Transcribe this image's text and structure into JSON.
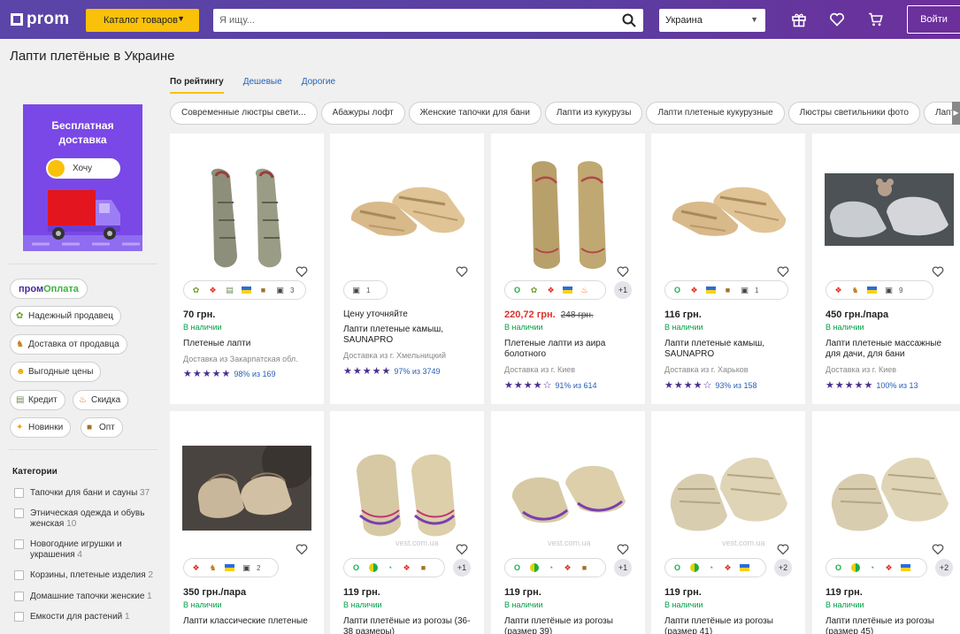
{
  "header": {
    "logo": "prom",
    "catalog_label": "Каталог товаров",
    "search_placeholder": "Я ищу...",
    "region": "Украина",
    "login_label": "Войти"
  },
  "page_title": "Лапти плетёные в Украине",
  "sort_tabs": [
    "По рейтингу",
    "Дешевые",
    "Дорогие"
  ],
  "chips": [
    "Современные люстры свети...",
    "Абажуры лофт",
    "Женские тапочки для бани",
    "Лапти из кукурузы",
    "Лапти плетеные кукурузные",
    "Люстры светильники фото",
    "Лапти"
  ],
  "promo": {
    "title_line1": "Бесплатная",
    "title_line2": "доставка",
    "toggle_label": "Хочу"
  },
  "prom_pay": {
    "part1": "пром",
    "part2": "Оплата"
  },
  "features": [
    "Надежный продавец",
    "Доставка от продавца",
    "Выгодные цены",
    "Кредит",
    "Скидка",
    "Новинки",
    "Опт"
  ],
  "categories_title": "Категории",
  "categories": [
    {
      "name": "Тапочки для бани и сауны",
      "count": "37"
    },
    {
      "name": "Этническая одежда и обувь женская",
      "count": "10"
    },
    {
      "name": "Новогодние игрушки и украшения",
      "count": "4"
    },
    {
      "name": "Корзины, плетеные изделия",
      "count": "2"
    },
    {
      "name": "Домашние тапочки женские",
      "count": "1"
    },
    {
      "name": "Емкости для растений",
      "count": "1"
    }
  ],
  "products": [
    {
      "price": "70 грн.",
      "old_price": "",
      "stock": "В наличии",
      "name": "Плетеные лапти",
      "delivery": "Доставка из Закарпатская обл.",
      "rating_pct": "98%",
      "rating_of": "из 169",
      "photos": "3",
      "plus": "",
      "stars": 5
    },
    {
      "price": "",
      "old_price": "",
      "stock": "Цену уточняйте",
      "name": "Лапти плетеные камыш, SAUNAPRO",
      "delivery": "Доставка из г. Хмельницкий",
      "rating_pct": "97%",
      "rating_of": "из 3749",
      "photos": "1",
      "plus": "",
      "stars": 5
    },
    {
      "price": "220,72 грн.",
      "old_price": "248 грн.",
      "stock": "В наличии",
      "name": "Плетеные лапти из аира болотного",
      "delivery": "Доставка из г. Киев",
      "rating_pct": "91%",
      "rating_of": "из 614",
      "photos": "",
      "plus": "+1",
      "stars": 4.5
    },
    {
      "price": "116 грн.",
      "old_price": "",
      "stock": "В наличии",
      "name": "Лапти плетеные камыш, SAUNAPRO",
      "delivery": "Доставка из г. Харьков",
      "rating_pct": "93%",
      "rating_of": "из 158",
      "photos": "1",
      "plus": "",
      "stars": 4.5
    },
    {
      "price": "450 грн./пара",
      "old_price": "",
      "stock": "В наличии",
      "name": "Лапти плетеные массажные для дачи, для бани",
      "delivery": "Доставка из г. Киев",
      "rating_pct": "100%",
      "rating_of": "из 13",
      "photos": "9",
      "plus": "",
      "stars": 5
    },
    {
      "price": "350 грн./пара",
      "old_price": "",
      "stock": "В наличии",
      "name": "Лапти классические плетеные",
      "delivery": "",
      "rating_pct": "",
      "rating_of": "",
      "photos": "2",
      "plus": "",
      "stars": 0
    },
    {
      "price": "119 грн.",
      "old_price": "",
      "stock": "В наличии",
      "name": "Лапти плетёные из рогозы (36-38 размеры)",
      "delivery": "",
      "rating_pct": "",
      "rating_of": "",
      "photos": "",
      "plus": "+1",
      "stars": 0
    },
    {
      "price": "119 грн.",
      "old_price": "",
      "stock": "В наличии",
      "name": "Лапти плетёные из рогозы (размер 39)",
      "delivery": "",
      "rating_pct": "",
      "rating_of": "",
      "photos": "",
      "plus": "+1",
      "stars": 0
    },
    {
      "price": "119 грн.",
      "old_price": "",
      "stock": "В наличии",
      "name": "Лапти плетёные из рогозы (размер 41)",
      "delivery": "",
      "rating_pct": "",
      "rating_of": "",
      "photos": "",
      "plus": "+2",
      "stars": 0
    },
    {
      "price": "119 грн.",
      "old_price": "",
      "stock": "В наличии",
      "name": "Лапти плетёные из рогозы (размер 45)",
      "delivery": "",
      "rating_pct": "",
      "rating_of": "",
      "photos": "",
      "plus": "+2",
      "stars": 0
    }
  ],
  "watermark": "vest.com.ua",
  "colors": {
    "header": "#5b45a8",
    "accent": "#f9c10a",
    "in_stock": "#00a046",
    "sale_price": "#e0302a",
    "link": "#2760b8",
    "stars": "#4a2e8e"
  },
  "icons": [
    "search-icon",
    "gift-icon",
    "heart-icon",
    "cart-icon",
    "chevron-down-icon"
  ]
}
